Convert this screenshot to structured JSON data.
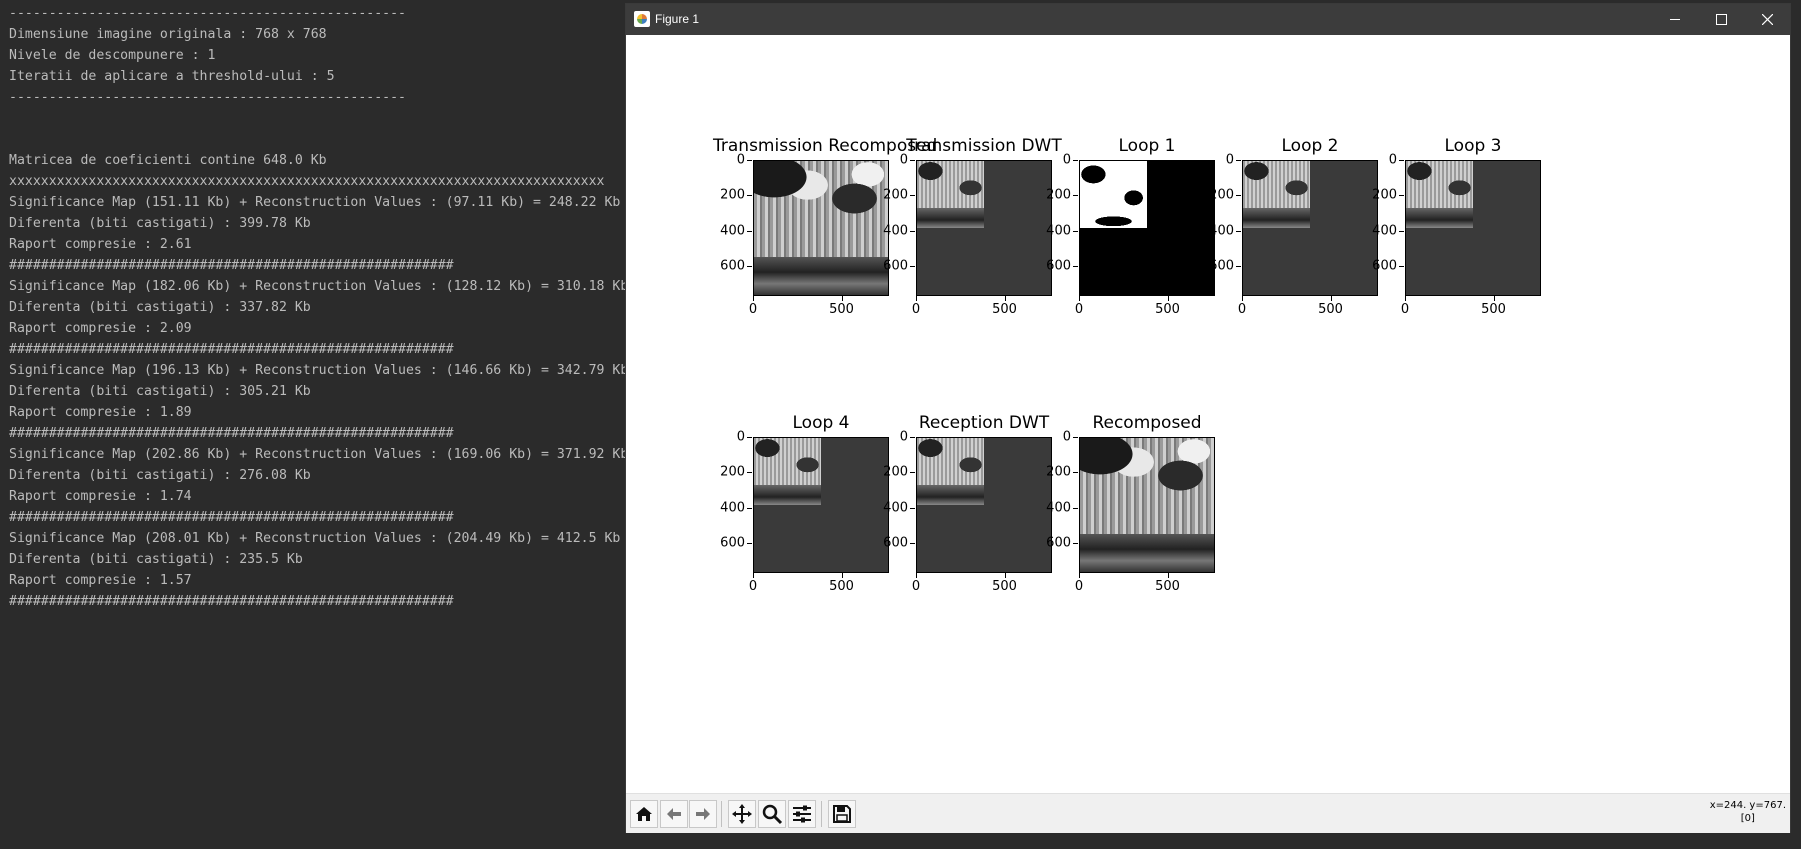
{
  "console": {
    "lines": [
      "--------------------------------------------------",
      "Dimensiune imagine originala : 768 x 768",
      "Nivele de descompunere : 1",
      "Iteratii de aplicare a threshold-ului : 5",
      "--------------------------------------------------",
      "",
      "",
      "Matricea de coeficienti contine 648.0 Kb",
      "xxxxxxxxxxxxxxxxxxxxxxxxxxxxxxxxxxxxxxxxxxxxxxxxxxxxxxxxxxxxxxxxxxxxxxxxxxx",
      "Significance Map (151.11 Kb) + Reconstruction Values : (97.11 Kb) = 248.22 Kb",
      "Diferenta (biti castigati) : 399.78 Kb",
      "Raport compresie : 2.61",
      "########################################################",
      "Significance Map (182.06 Kb) + Reconstruction Values : (128.12 Kb) = 310.18 Kb",
      "Diferenta (biti castigati) : 337.82 Kb",
      "Raport compresie : 2.09",
      "########################################################",
      "Significance Map (196.13 Kb) + Reconstruction Values : (146.66 Kb) = 342.79 Kb",
      "Diferenta (biti castigati) : 305.21 Kb",
      "Raport compresie : 1.89",
      "########################################################",
      "Significance Map (202.86 Kb) + Reconstruction Values : (169.06 Kb) = 371.92 Kb",
      "Diferenta (biti castigati) : 276.08 Kb",
      "Raport compresie : 1.74",
      "########################################################",
      "Significance Map (208.01 Kb) + Reconstruction Values : (204.49 Kb) = 412.5 Kb",
      "Diferenta (biti castigati) : 235.5 Kb",
      "Raport compresie : 1.57",
      "########################################################"
    ]
  },
  "window": {
    "title": "Figure 1",
    "icons": {
      "app": "matplotlib-icon",
      "minimize": "minimize-icon",
      "maximize": "maximize-icon",
      "close": "close-icon"
    }
  },
  "figure": {
    "y_ticks": [
      "0",
      "200",
      "400",
      "600"
    ],
    "y_tick_values": [
      0,
      200,
      400,
      600
    ],
    "x_ticks": [
      "0",
      "500"
    ],
    "x_tick_values": [
      0,
      500
    ],
    "image_extent": 768,
    "subplots": [
      {
        "title": "Transmission Recomposed",
        "content": "full-image"
      },
      {
        "title": "Transmission DWT",
        "content": "dwt-quadrant"
      },
      {
        "title": "Loop 1",
        "content": "thresholded-quadrant"
      },
      {
        "title": "Loop 2",
        "content": "dwt-quadrant"
      },
      {
        "title": "Loop 3",
        "content": "dwt-quadrant"
      },
      {
        "title": "Loop 4",
        "content": "dwt-quadrant"
      },
      {
        "title": "Reception DWT",
        "content": "dwt-quadrant"
      },
      {
        "title": "Recomposed",
        "content": "full-image"
      }
    ]
  },
  "toolbar": {
    "buttons": [
      "home-icon",
      "back-icon",
      "forward-icon",
      "pan-icon",
      "zoom-icon",
      "configure-subplots-icon",
      "save-icon"
    ],
    "coords_line1": "x=244. y=767.",
    "coords_line2": "[0]"
  }
}
